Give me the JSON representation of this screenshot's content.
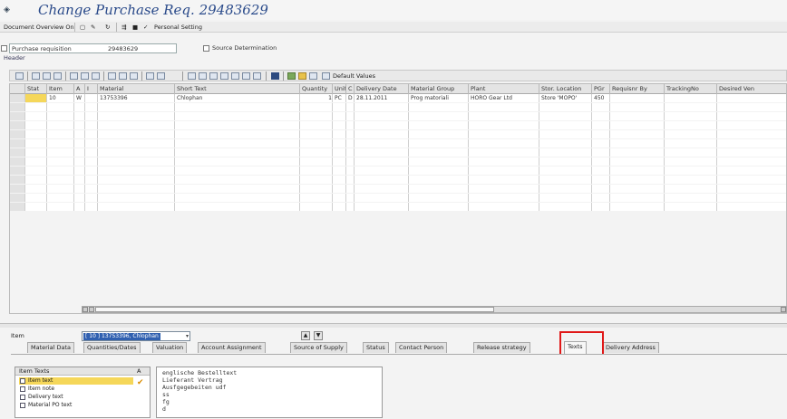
{
  "title": "Change Purchase Req. 29483629",
  "appbar": {
    "doc_overview": "Document Overview On",
    "personal_setting": "Personal Setting"
  },
  "selection": {
    "doc_type": "Purchase requisition",
    "doc_number": "29483629",
    "source_determination": "Source Determination"
  },
  "header_label": "Header",
  "toolbar": {
    "default_values": "Default Values"
  },
  "grid": {
    "columns": [
      "Stat",
      "Item",
      "A",
      "I",
      "Material",
      "Short Text",
      "Quantity",
      "Unit",
      "C",
      "Delivery Date",
      "Material Group",
      "Plant",
      "Stor. Location",
      "PGr",
      "Requisnr By",
      "TrackingNo",
      "Desired Ven"
    ],
    "rows": [
      {
        "item": "10",
        "a": "W",
        "material": "13753396",
        "short_text": "Chlophan",
        "quantity": "1",
        "unit": "PC",
        "c": "D",
        "delivery_date": "28.11.2011",
        "material_group": "Prog matoriali",
        "plant": "HORO Gear Ltd",
        "stor_location": "Store 'MOPO'",
        "pgr": "450",
        "requisnr": "",
        "tracking": "",
        "vendor": ""
      }
    ]
  },
  "item_bar": {
    "label": "Item",
    "selected": "[ 10 ] 13753396, Chlophan"
  },
  "tabs": [
    "Material Data",
    "Quantities/Dates",
    "Valuation",
    "Account Assignment",
    "Source of Supply",
    "Status",
    "Contact Person",
    "Release strategy",
    "Texts",
    "Delivery Address"
  ],
  "tree": {
    "header": "Item Texts",
    "header_col": "A",
    "items": [
      "Item text",
      "Item note",
      "Delivery text",
      "Material PO text"
    ]
  },
  "editor_lines": [
    "englische Bestelltext",
    "Lieferant Vertrag",
    "Ausfgegebeiten udf",
    "ss",
    "fg",
    "d"
  ]
}
